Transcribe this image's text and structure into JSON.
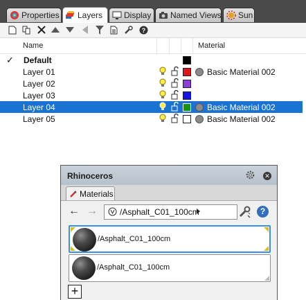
{
  "tabs": [
    {
      "label": "Properties",
      "icon": "properties-icon"
    },
    {
      "label": "Layers",
      "icon": "layers-icon",
      "active": true
    },
    {
      "label": "Display",
      "icon": "display-icon"
    },
    {
      "label": "Named Views",
      "icon": "camera-icon"
    },
    {
      "label": "Sun",
      "icon": "sun-icon"
    }
  ],
  "columns": {
    "name": "Name",
    "material": "Material"
  },
  "layers": [
    {
      "name": "Default",
      "current": true,
      "color": "#000000"
    },
    {
      "name": "Layer 01",
      "color": "#e0141b",
      "material": "Basic Material 002"
    },
    {
      "name": "Layer 02",
      "color": "#8b3fd6"
    },
    {
      "name": "Layer 03",
      "color": "#1414e8"
    },
    {
      "name": "Layer 04",
      "color": "#149614",
      "material": "Basic Material 002",
      "selected": true
    },
    {
      "name": "Layer 05",
      "color": "#ffffff",
      "material": "Basic Material 002"
    }
  ],
  "rhino": {
    "title": "Rhinoceros",
    "tab": "Materials",
    "path": "/Asphalt_C01_100cm",
    "help": "?",
    "materials": [
      {
        "label": "/Asphalt_C01_100cm",
        "selected": true
      },
      {
        "label": "/Asphalt_C01_100cm",
        "selected": false
      }
    ],
    "add": "+"
  },
  "colors": {
    "selection": "#1a72d2",
    "accent": "#3b8ee0"
  }
}
